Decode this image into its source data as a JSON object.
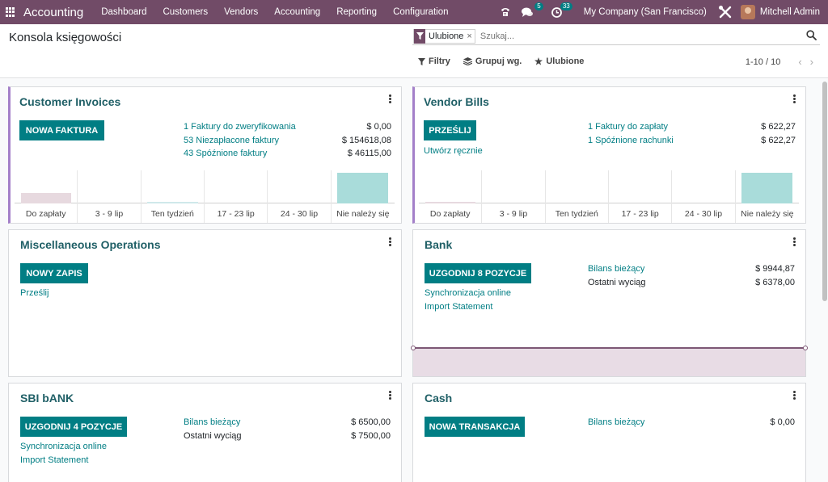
{
  "navbar": {
    "brand": "Accounting",
    "menu": [
      "Dashboard",
      "Customers",
      "Vendors",
      "Accounting",
      "Reporting",
      "Configuration"
    ],
    "messages_count": "5",
    "activities_count": "33",
    "company": "My Company (San Francisco)",
    "user": "Mitchell Admin"
  },
  "control": {
    "title": "Konsola księgowości",
    "facet_label": "Ulubione",
    "facet_close": "×",
    "search_placeholder": "Szukaj...",
    "filters_label": "Filtry",
    "groupby_label": "Grupuj wg.",
    "favorites_label": "Ulubione",
    "pager_value": "1-10 / 10",
    "pager_prev": "‹",
    "pager_next": "›"
  },
  "cards": {
    "customer_invoices": {
      "title": "Customer Invoices",
      "button": "NOWA FAKTURA",
      "rows": [
        {
          "label": "1 Faktury do zweryfikowania",
          "value": "$ 0,00"
        },
        {
          "label": "53 Niezapłacone faktury",
          "value": "$ 154618,08"
        },
        {
          "label": "43 Spóźnione faktury",
          "value": "$ 46115,00"
        }
      ],
      "chart": {
        "categories": [
          "Do zapłaty",
          "3 - 9 lip",
          "Ten tydzień",
          "17 - 23 lip",
          "24 - 30 lip",
          "Nie należy się"
        ],
        "bars": [
          0.35,
          0,
          0.05,
          0,
          0,
          1.0
        ],
        "colors": [
          "#e7d9df",
          "#e7d9df",
          "#cfe8ea",
          "#e7d9df",
          "#e7d9df",
          "#a9dcda"
        ]
      }
    },
    "vendor_bills": {
      "title": "Vendor Bills",
      "button": "PRZEŚLIJ",
      "link": "Utwórz ręcznie",
      "rows": [
        {
          "label": "1 Faktury do zapłaty",
          "value": "$ 622,27"
        },
        {
          "label": "1 Spóźnione rachunki",
          "value": "$ 622,27"
        }
      ],
      "chart": {
        "categories": [
          "Do zapłaty",
          "3 - 9 lip",
          "Ten tydzień",
          "17 - 23 lip",
          "24 - 30 lip",
          "Nie należy się"
        ],
        "bars": [
          0.05,
          0,
          0,
          0,
          0,
          1.0
        ],
        "colors": [
          "#e7d9df",
          "#e7d9df",
          "#e7d9df",
          "#e7d9df",
          "#e7d9df",
          "#a9dcda"
        ]
      }
    },
    "misc": {
      "title": "Miscellaneous Operations",
      "button": "NOWY ZAPIS",
      "link": "Prześlij"
    },
    "bank": {
      "title": "Bank",
      "button": "UZGODNIJ 8 POZYCJE",
      "links": [
        "Synchronizacja online",
        "Import Statement"
      ],
      "rows": [
        {
          "label": "Bilans bieżący",
          "value": "$ 9944,87"
        },
        {
          "label": "Ostatni wyciąg",
          "value": "$ 6378,00"
        }
      ]
    },
    "sbi": {
      "title": "SBI bANK",
      "button": "UZGODNIJ 4 POZYCJE",
      "links": [
        "Synchronizacja online",
        "Import Statement"
      ],
      "rows": [
        {
          "label": "Bilans bieżący",
          "value": "$ 6500,00"
        },
        {
          "label": "Ostatni wyciąg",
          "value": "$ 7500,00"
        }
      ]
    },
    "cash": {
      "title": "Cash",
      "button": "NOWA TRANSAKCJA",
      "rows": [
        {
          "label": "Bilans bieżący",
          "value": "$ 0,00"
        }
      ]
    }
  },
  "colors": {
    "navbar": "#714b67",
    "primary": "#017e84",
    "title": "#1f5f66",
    "accent": "#a480c9"
  }
}
